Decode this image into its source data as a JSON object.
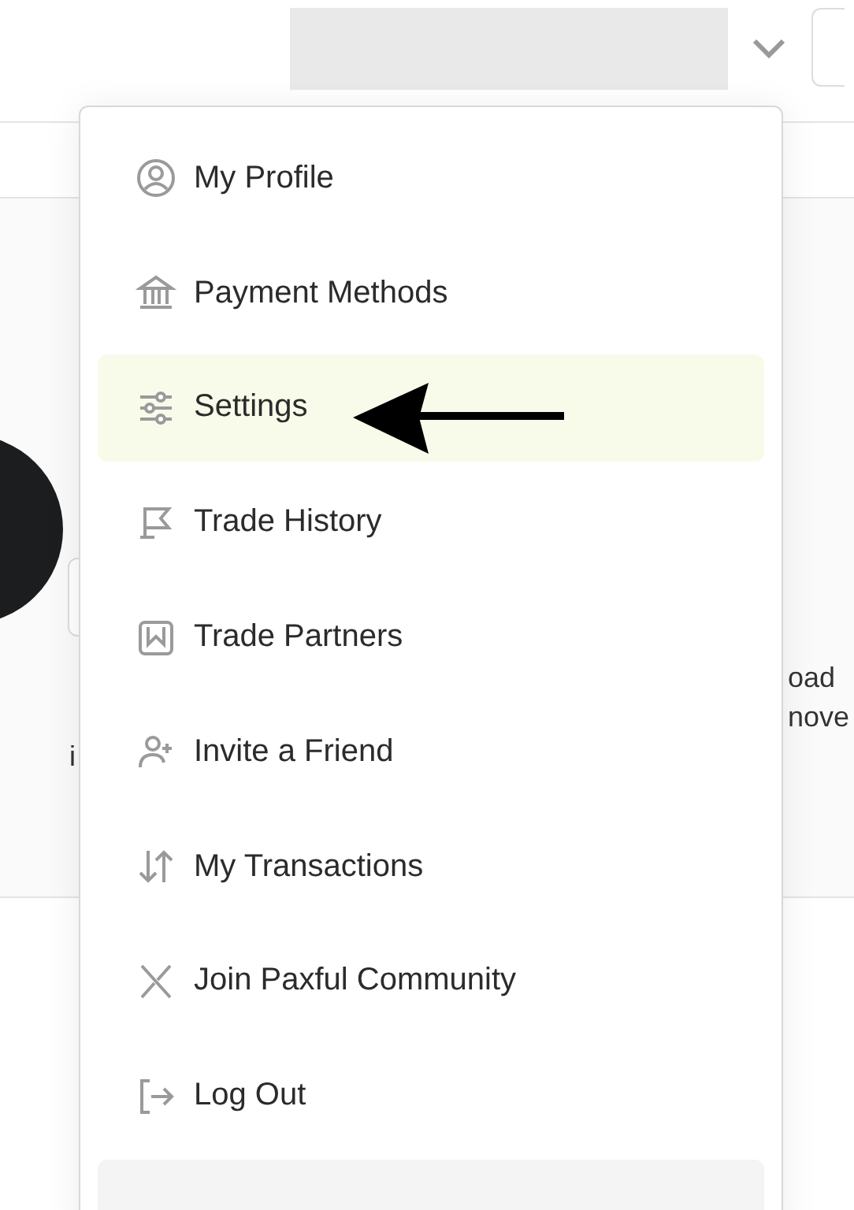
{
  "background": {
    "left_fragments": [
      "i"
    ],
    "right_fragments": [
      "oad",
      "nove"
    ]
  },
  "menu": {
    "items": [
      {
        "label": "My Profile",
        "selected": false
      },
      {
        "label": "Payment Methods",
        "selected": false
      },
      {
        "label": "Settings",
        "selected": true
      },
      {
        "label": "Trade History",
        "selected": false
      },
      {
        "label": "Trade Partners",
        "selected": false
      },
      {
        "label": "Invite a Friend",
        "selected": false
      },
      {
        "label": "My Transactions",
        "selected": false
      },
      {
        "label": "Join Paxful Community",
        "selected": false
      },
      {
        "label": "Log Out",
        "selected": false
      }
    ]
  }
}
